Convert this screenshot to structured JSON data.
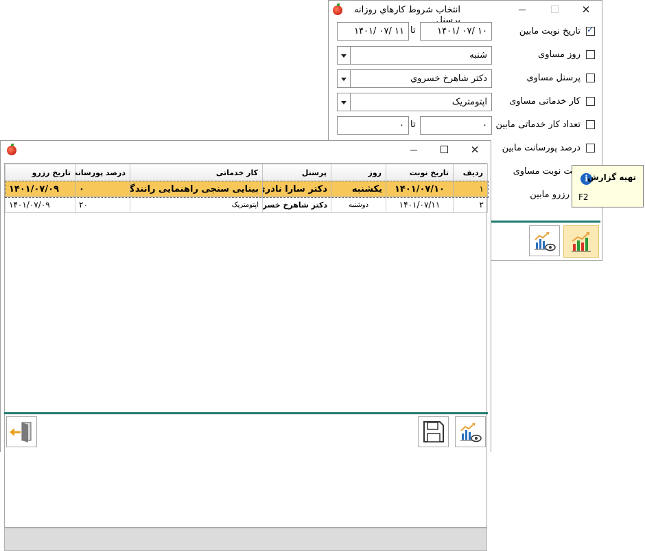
{
  "filter_window": {
    "title": "انتخاب شروط كارهاي روزانه پرسنل",
    "rows": [
      {
        "label": "تاريخ نوبت مابين",
        "checked": true
      },
      {
        "label": "روز مساوی",
        "checked": false
      },
      {
        "label": "پرسنل مساوی",
        "checked": false
      },
      {
        "label": "کار خدماتی مساوی",
        "checked": false
      },
      {
        "label": "تعداد کار خدماتی مابین",
        "checked": false
      },
      {
        "label": "درصد پورسانت مابین",
        "checked": false
      },
      {
        "label": "عیت نوبت مساوی",
        "checked": false
      },
      {
        "label": "یخ رزرو مابین",
        "checked": false
      }
    ],
    "date_from": "۱۰ /۰۷ /۱۴۰۱",
    "date_to": "۱۱ /۰۷ /۱۴۰۱",
    "to_word": "تا",
    "day_value": "شنبه",
    "personnel_value": "دکتر شاهرخ خسروي",
    "service_value": "اپتومتریک",
    "count_from": "۰",
    "count_to": "۰"
  },
  "tooltip": {
    "title": "تهیه گزارش",
    "shortcut": "F2",
    "info_icon": "i"
  },
  "report_window": {
    "columns": [
      "ردیف",
      "تاریخ نوبت",
      "روز",
      "پرسنل",
      "کار خدماتی",
      "درصد پورسانت",
      "تاریخ رزرو"
    ],
    "rows": [
      {
        "index": "۱",
        "date": "۱۴۰۱/۰۷/۱۰",
        "day": "یکشنبه",
        "personnel": "دکتر سارا نادری",
        "service": "بینایی سنجی راهنمایی رانندگی",
        "percent": "۰",
        "reserve": "۱۴۰۱/۰۷/۰۹",
        "selected": true
      },
      {
        "index": "۲",
        "date": "۱۴۰۱/۰۷/۱۱",
        "day": "دوشنبه",
        "personnel": "دکتر شاهرخ خسروی",
        "service": "اپتومتریک",
        "percent": "۲۰",
        "reserve": "۱۴۰۱/۰۷/۰۹",
        "selected": false
      }
    ]
  },
  "colors": {
    "accent_teal": "#1f7a6e",
    "selected_row": "#f7c75a",
    "tooltip_bg": "#ffffe1"
  }
}
